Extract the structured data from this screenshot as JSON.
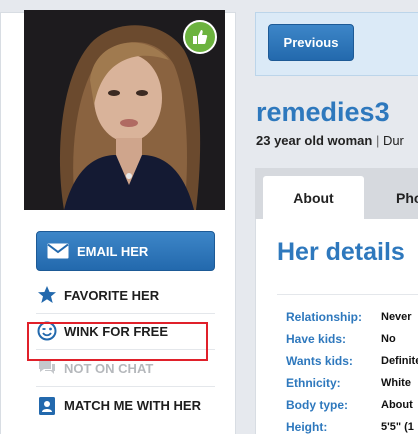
{
  "profile": {
    "photo_alt": "profile photo",
    "badge_icon": "thumbs-up-icon"
  },
  "actions": {
    "email_label": "EMAIL HER",
    "favorite_label": "FAVORITE HER",
    "wink_label": "WINK FOR FREE",
    "chat_label": "NOT ON CHAT",
    "match_label": "MATCH ME WITH HER"
  },
  "nav": {
    "previous_label": "Previous"
  },
  "header": {
    "username": "remedies3",
    "age_gender": "23 year old woman",
    "separator": " | ",
    "location_partial": "Dur"
  },
  "tabs": [
    {
      "label": "About"
    },
    {
      "label": "Pho"
    }
  ],
  "details": {
    "title": "Her details",
    "rows": [
      {
        "label": "Relationship:",
        "value": "Never"
      },
      {
        "label": "Have kids:",
        "value": "No"
      },
      {
        "label": "Wants kids:",
        "value": "Definite"
      },
      {
        "label": "Ethnicity:",
        "value": "White"
      },
      {
        "label": "Body type:",
        "value": "About"
      },
      {
        "label": "Height:",
        "value": "5'5\" (1"
      }
    ]
  },
  "colors": {
    "accent_blue": "#2e78bd",
    "button_blue": "#2369ad",
    "badge_green": "#6cb33f",
    "highlight_red": "#e0202a"
  }
}
